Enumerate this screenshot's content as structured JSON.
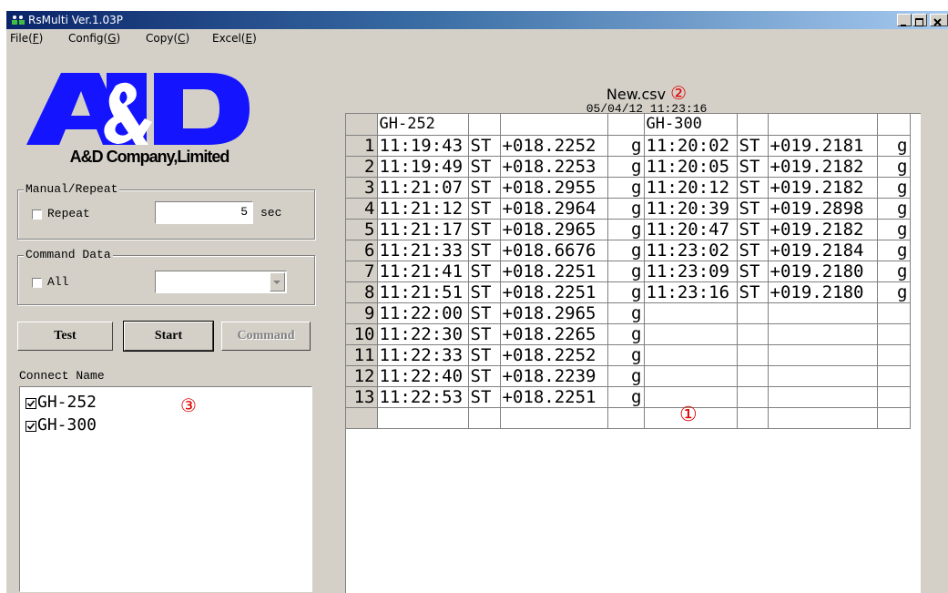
{
  "window": {
    "title": "RsMulti Ver.1.03P"
  },
  "menu": [
    {
      "label": "File(",
      "key": "F",
      "close": ")"
    },
    {
      "label": "Config(",
      "key": "G",
      "close": ")"
    },
    {
      "label": "Copy(",
      "key": "C",
      "close": ")"
    },
    {
      "label": "Excel(",
      "key": "E",
      "close": ")"
    }
  ],
  "logo": {
    "text": "A&D",
    "company": "A&D Company,Limited",
    "color": "#1414ff"
  },
  "manual_repeat": {
    "group_label": "Manual/Repeat",
    "repeat_label": "Repeat",
    "repeat_checked": false,
    "interval_value": "5",
    "unit": "sec"
  },
  "command_data": {
    "group_label": "Command Data",
    "all_label": "All",
    "all_checked": false,
    "selected": ""
  },
  "buttons": {
    "test": "Test",
    "start": "Start",
    "command": "Command"
  },
  "connect": {
    "label": "Connect Name",
    "items": [
      {
        "name": "GH-252",
        "checked": true
      },
      {
        "name": "GH-300",
        "checked": true
      }
    ]
  },
  "annotations": {
    "one": "①",
    "two": "②",
    "three": "③",
    "color": "#e00000"
  },
  "file": {
    "name": "New.csv",
    "datetime": "05/04/12  11:23:16"
  },
  "table": {
    "headers": [
      "",
      "GH-252",
      "",
      "",
      "",
      "GH-300",
      "",
      "",
      ""
    ],
    "rows": [
      [
        "1",
        "11:19:43",
        "ST",
        "+018.2252",
        "g",
        "11:20:02",
        "ST",
        "+019.2181",
        "g"
      ],
      [
        "2",
        "11:19:49",
        "ST",
        "+018.2253",
        "g",
        "11:20:05",
        "ST",
        "+019.2182",
        "g"
      ],
      [
        "3",
        "11:21:07",
        "ST",
        "+018.2955",
        "g",
        "11:20:12",
        "ST",
        "+019.2182",
        "g"
      ],
      [
        "4",
        "11:21:12",
        "ST",
        "+018.2964",
        "g",
        "11:20:39",
        "ST",
        "+019.2898",
        "g"
      ],
      [
        "5",
        "11:21:17",
        "ST",
        "+018.2965",
        "g",
        "11:20:47",
        "ST",
        "+019.2182",
        "g"
      ],
      [
        "6",
        "11:21:33",
        "ST",
        "+018.6676",
        "g",
        "11:23:02",
        "ST",
        "+019.2184",
        "g"
      ],
      [
        "7",
        "11:21:41",
        "ST",
        "+018.2251",
        "g",
        "11:23:09",
        "ST",
        "+019.2180",
        "g"
      ],
      [
        "8",
        "11:21:51",
        "ST",
        "+018.2251",
        "g",
        "11:23:16",
        "ST",
        "+019.2180",
        "g"
      ],
      [
        "9",
        "11:22:00",
        "ST",
        "+018.2965",
        "g",
        "",
        "",
        "",
        ""
      ],
      [
        "10",
        "11:22:30",
        "ST",
        "+018.2265",
        "g",
        "",
        "",
        "",
        ""
      ],
      [
        "11",
        "11:22:33",
        "ST",
        "+018.2252",
        "g",
        "",
        "",
        "",
        ""
      ],
      [
        "12",
        "11:22:40",
        "ST",
        "+018.2239",
        "g",
        "",
        "",
        "",
        ""
      ],
      [
        "13",
        "11:22:53",
        "ST",
        "+018.2251",
        "g",
        "",
        "",
        "",
        ""
      ],
      [
        "",
        "",
        "",
        "",
        "",
        "",
        "",
        "",
        ""
      ]
    ]
  }
}
